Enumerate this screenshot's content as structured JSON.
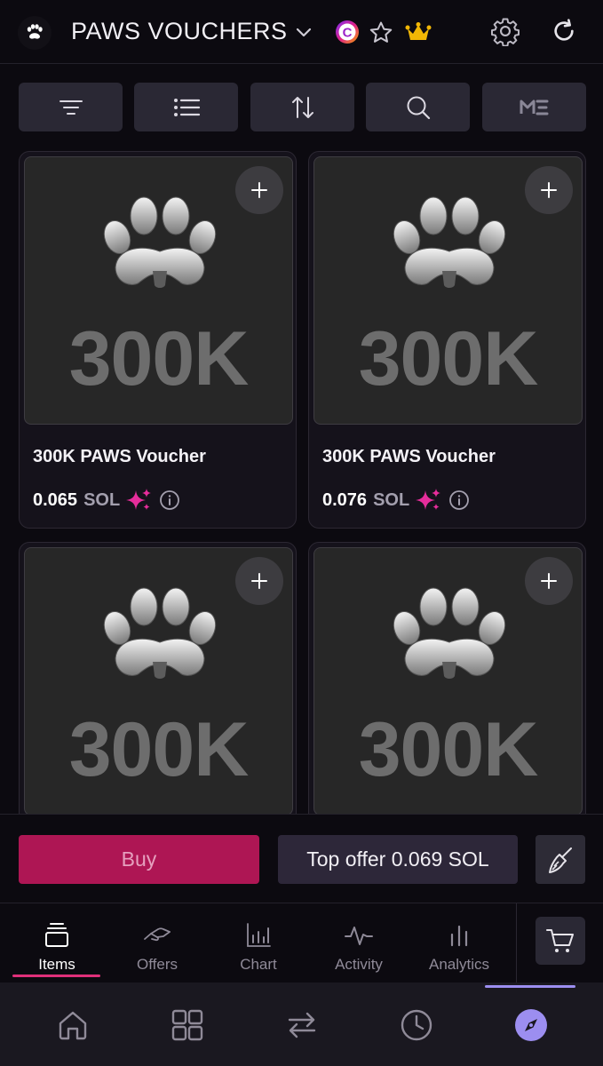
{
  "header": {
    "title": "PAWS VOUCHERS",
    "badge_letter": "C"
  },
  "toolbar": {
    "buttons": [
      "filter",
      "list-view",
      "sort",
      "search",
      "magic-eden"
    ],
    "me_label": "ME"
  },
  "cards": [
    {
      "amount": "300K",
      "name": "300K PAWS Voucher",
      "price": "0.065",
      "currency": "SOL"
    },
    {
      "amount": "300K",
      "name": "300K PAWS Voucher",
      "price": "0.076",
      "currency": "SOL"
    },
    {
      "amount": "300K",
      "name": "",
      "price": "",
      "currency": ""
    },
    {
      "amount": "300K",
      "name": "",
      "price": "",
      "currency": ""
    }
  ],
  "actions": {
    "buy_label": "Buy",
    "top_offer_label": "Top offer 0.069 SOL"
  },
  "tabs": [
    {
      "label": "Items",
      "icon": "items-icon",
      "active": true
    },
    {
      "label": "Offers",
      "icon": "offers-icon",
      "active": false
    },
    {
      "label": "Chart",
      "icon": "chart-icon",
      "active": false
    },
    {
      "label": "Activity",
      "icon": "activity-icon",
      "active": false
    },
    {
      "label": "Analytics",
      "icon": "analytics-icon",
      "active": false
    }
  ],
  "bottom_nav": [
    "home-icon",
    "grid-icon",
    "swap-icon",
    "clock-icon",
    "compass-icon"
  ],
  "colors": {
    "background": "#0c0a10",
    "buy": "#ae1654",
    "accent_pink": "#e0307a",
    "sparkle": "#e62d9b",
    "crown": "#f2b705",
    "nav_indicator": "#9c8ef0"
  }
}
